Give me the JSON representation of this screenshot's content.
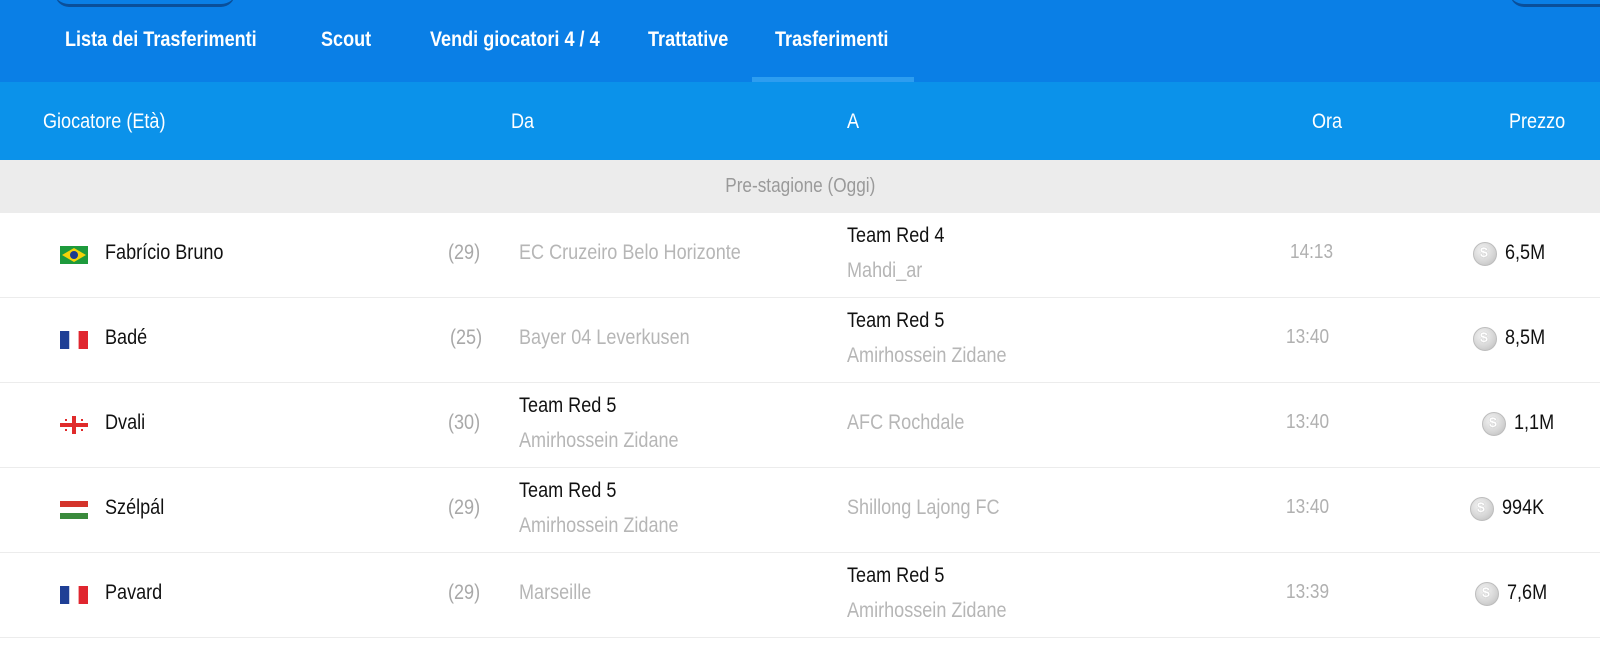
{
  "nav": {
    "tabs": [
      "Lista dei Trasferimenti",
      "Scout",
      "Vendi giocatori 4 / 4",
      "Trattative",
      "Trasferimenti"
    ],
    "active_tab": "Trasferimenti"
  },
  "table": {
    "headers": {
      "player": "Giocatore (Età)",
      "from": "Da",
      "to": "A",
      "time": "Ora",
      "price": "Prezzo"
    },
    "section_label": "Pre-stagione (Oggi)",
    "rows": [
      {
        "flag": "brazil-flag-icon",
        "name": "Fabrício Bruno",
        "age": "(29)",
        "from": {
          "team": "EC Cruzeiro Belo Horizonte",
          "manager": ""
        },
        "to": {
          "team": "Team Red 4",
          "manager": "Mahdi_ar"
        },
        "time": "14:13",
        "price": "6,5M"
      },
      {
        "flag": "france-flag-icon",
        "name": "Badé",
        "age": "(25)",
        "from": {
          "team": "Bayer 04 Leverkusen",
          "manager": ""
        },
        "to": {
          "team": "Team Red 5",
          "manager": "Amirhossein Zidane"
        },
        "time": "13:40",
        "price": "8,5M"
      },
      {
        "flag": "georgia-flag-icon",
        "name": "Dvali",
        "age": "(30)",
        "from": {
          "team": "Team Red 5",
          "manager": "Amirhossein Zidane"
        },
        "to": {
          "team": "AFC Rochdale",
          "manager": ""
        },
        "time": "13:40",
        "price": "1,1M"
      },
      {
        "flag": "hungary-flag-icon",
        "name": "Szélpál",
        "age": "(29)",
        "from": {
          "team": "Team Red 5",
          "manager": "Amirhossein Zidane"
        },
        "to": {
          "team": "Shillong Lajong FC",
          "manager": ""
        },
        "time": "13:40",
        "price": "994K"
      },
      {
        "flag": "france-flag-icon",
        "name": "Pavard",
        "age": "(29)",
        "from": {
          "team": "Marseille",
          "manager": ""
        },
        "to": {
          "team": "Team Red 5",
          "manager": "Amirhossein Zidane"
        },
        "time": "13:39",
        "price": "7,6M"
      }
    ]
  },
  "colors": {
    "nav_bg": "#0a7fe6",
    "header_bg": "#0b92ea",
    "section_bg": "#ececec"
  }
}
